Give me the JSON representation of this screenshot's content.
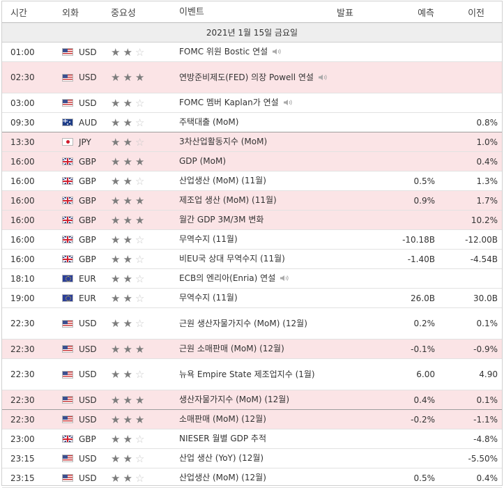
{
  "header": {
    "time": "시간",
    "currency": "외화",
    "importance": "중요성",
    "event": "이벤트",
    "actual": "발표",
    "forecast": "예측",
    "previous": "이전"
  },
  "date_label": "2021년 1월 15일 금요일",
  "colors": {
    "highlight": "#fbe4e6",
    "star_on": "#7d7d7d",
    "star_off": "#c9c9c9"
  },
  "rows": [
    {
      "time": "01:00",
      "flag": "usd",
      "cur": "USD",
      "stars": 2,
      "event": "FOMC 위원 Bostic 연설",
      "speech": true,
      "actual": "",
      "forecast": "",
      "previous": ""
    },
    {
      "time": "02:30",
      "flag": "usd",
      "cur": "USD",
      "stars": 3,
      "event": "연방준비제도(FED) 의장 Powell 연설",
      "speech": true,
      "actual": "",
      "forecast": "",
      "previous": ""
    },
    {
      "time": "03:00",
      "flag": "usd",
      "cur": "USD",
      "stars": 2,
      "event": "FOMC 멤버 Kaplan가 연설",
      "speech": true,
      "actual": "",
      "forecast": "",
      "previous": ""
    },
    {
      "time": "09:30",
      "flag": "aud",
      "cur": "AUD",
      "stars": 2,
      "event": "주택대출 (MoM)",
      "speech": false,
      "actual": "",
      "forecast": "",
      "previous": "0.8%"
    },
    {
      "time": "13:30",
      "flag": "jpy",
      "cur": "JPY",
      "stars": 2,
      "event": "3차산업활동지수 (MoM)",
      "speech": false,
      "actual": "",
      "forecast": "",
      "previous": "1.0%"
    },
    {
      "time": "16:00",
      "flag": "gbp",
      "cur": "GBP",
      "stars": 3,
      "event": "GDP (MoM)",
      "speech": false,
      "actual": "",
      "forecast": "",
      "previous": "0.4%"
    },
    {
      "time": "16:00",
      "flag": "gbp",
      "cur": "GBP",
      "stars": 2,
      "event": "산업생산 (MoM) (11월)",
      "speech": false,
      "actual": "",
      "forecast": "0.5%",
      "previous": "1.3%"
    },
    {
      "time": "16:00",
      "flag": "gbp",
      "cur": "GBP",
      "stars": 3,
      "event": "제조업 생산 (MoM) (11월)",
      "speech": false,
      "actual": "",
      "forecast": "0.9%",
      "previous": "1.7%"
    },
    {
      "time": "16:00",
      "flag": "gbp",
      "cur": "GBP",
      "stars": 3,
      "event": "월간 GDP 3M/3M 변화",
      "speech": false,
      "actual": "",
      "forecast": "",
      "previous": "10.2%"
    },
    {
      "time": "16:00",
      "flag": "gbp",
      "cur": "GBP",
      "stars": 2,
      "event": "무역수지 (11월)",
      "speech": false,
      "actual": "",
      "forecast": "-10.18B",
      "previous": "-12.00B"
    },
    {
      "time": "16:00",
      "flag": "gbp",
      "cur": "GBP",
      "stars": 2,
      "event": "비EU국 상대 무역수지 (11월)",
      "speech": false,
      "actual": "",
      "forecast": "-1.40B",
      "previous": "-4.54B"
    },
    {
      "time": "18:10",
      "flag": "eur",
      "cur": "EUR",
      "stars": 2,
      "event": "ECB의 엔리아(Enria) 연설",
      "speech": true,
      "actual": "",
      "forecast": "",
      "previous": ""
    },
    {
      "time": "19:00",
      "flag": "eur",
      "cur": "EUR",
      "stars": 2,
      "event": "무역수지 (11월)",
      "speech": false,
      "actual": "",
      "forecast": "26.0B",
      "previous": "30.0B"
    },
    {
      "time": "22:30",
      "flag": "usd",
      "cur": "USD",
      "stars": 2,
      "event": "근원 생산자물가지수 (MoM) (12월)",
      "speech": false,
      "actual": "",
      "forecast": "0.2%",
      "previous": "0.1%"
    },
    {
      "time": "22:30",
      "flag": "usd",
      "cur": "USD",
      "stars": 3,
      "event": "근원 소매판매 (MoM) (12월)",
      "speech": false,
      "actual": "",
      "forecast": "-0.1%",
      "previous": "-0.9%"
    },
    {
      "time": "22:30",
      "flag": "usd",
      "cur": "USD",
      "stars": 2,
      "event": "뉴욕 Empire State 제조업지수 (1월)",
      "speech": false,
      "actual": "",
      "forecast": "6.00",
      "previous": "4.90"
    },
    {
      "time": "22:30",
      "flag": "usd",
      "cur": "USD",
      "stars": 3,
      "event": "생산자물가지수 (MoM) (12월)",
      "speech": false,
      "actual": "",
      "forecast": "0.4%",
      "previous": "0.1%"
    },
    {
      "time": "22:30",
      "flag": "usd",
      "cur": "USD",
      "stars": 3,
      "event": "소매판매 (MoM) (12월)",
      "speech": false,
      "actual": "",
      "forecast": "-0.2%",
      "previous": "-1.1%"
    },
    {
      "time": "23:00",
      "flag": "gbp",
      "cur": "GBP",
      "stars": 2,
      "event": "NIESER 월별 GDP 추적",
      "speech": false,
      "actual": "",
      "forecast": "",
      "previous": "-4.8%"
    },
    {
      "time": "23:15",
      "flag": "usd",
      "cur": "USD",
      "stars": 2,
      "event": "산업 생산 (YoY) (12월)",
      "speech": false,
      "actual": "",
      "forecast": "",
      "previous": "-5.50%"
    },
    {
      "time": "23:15",
      "flag": "usd",
      "cur": "USD",
      "stars": 2,
      "event": "산업생산 (MoM) (12월)",
      "speech": false,
      "actual": "",
      "forecast": "0.5%",
      "previous": "0.4%"
    }
  ]
}
